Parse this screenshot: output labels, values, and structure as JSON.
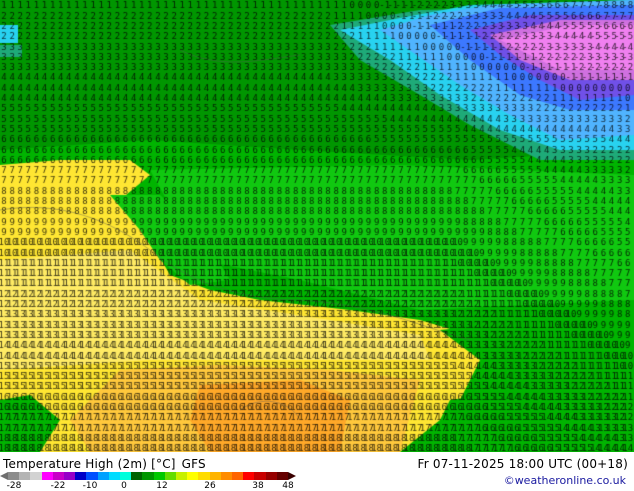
{
  "footer": {
    "title_left": "Temperature High (2m) [°C]",
    "title_model": "GFS",
    "valid_time": "Fr 07-11-2025 18:00 UTC (00+18)",
    "credit": "©weatheronline.co.uk"
  },
  "colorbar": {
    "ticks": [
      "-28",
      "-22",
      "-10",
      "0",
      "12",
      "26",
      "38",
      "48"
    ],
    "colors": [
      "#8c8c8c",
      "#b4b4b4",
      "#d2d2d2",
      "#ff00ff",
      "#c800c8",
      "#9600c8",
      "#0000c8",
      "#0050ff",
      "#00a0ff",
      "#00dcff",
      "#00ffdc",
      "#006400",
      "#009600",
      "#00c800",
      "#64dc00",
      "#c8f000",
      "#ffff00",
      "#ffdc00",
      "#ffb400",
      "#ff8c00",
      "#ff6400",
      "#ff0000",
      "#c80000",
      "#960000",
      "#640000"
    ]
  },
  "map_data": {
    "palette": {
      "pink": "#f080f0",
      "magenta": "#d070e0",
      "purple": "#7050e8",
      "blue": "#3c78ff",
      "lightblue": "#50b4ff",
      "cyan": "#28d2f0",
      "teal": "#1eaa78",
      "darkgreen": "#009600",
      "green": "#00b400",
      "lightgreen": "#10c810",
      "yellow": "#ffe632",
      "paleyellow": "#ffeb64",
      "orange": "#ffc83c",
      "deeporange": "#ffa828"
    },
    "labels": [
      {
        "region": "nw",
        "values": [
          "-2",
          "-1",
          "-1",
          "0",
          "1",
          "2",
          "2",
          "3",
          "3",
          "4",
          "4"
        ]
      },
      {
        "region": "north",
        "values": [
          "2",
          "2",
          "3",
          "3",
          "4",
          "3",
          "2",
          "1",
          "0",
          "0",
          "0"
        ]
      },
      {
        "region": "northeast",
        "values": [
          "-2",
          "-3",
          "-5",
          "-6",
          "-7",
          "-5",
          "-3",
          "-2",
          "-1",
          "1",
          "2",
          "3"
        ]
      },
      {
        "region": "middle",
        "values": [
          "5",
          "6",
          "7",
          "7",
          "8",
          "8",
          "9",
          "9",
          "10",
          "10",
          "11"
        ]
      },
      {
        "region": "south",
        "values": [
          "11",
          "12",
          "13",
          "13",
          "14",
          "14",
          "15",
          "16",
          "17",
          "18",
          "20"
        ]
      },
      {
        "region": "east",
        "values": [
          "3",
          "4",
          "5",
          "5",
          "6",
          "6",
          "7",
          "8",
          "9",
          "10"
        ]
      }
    ]
  }
}
